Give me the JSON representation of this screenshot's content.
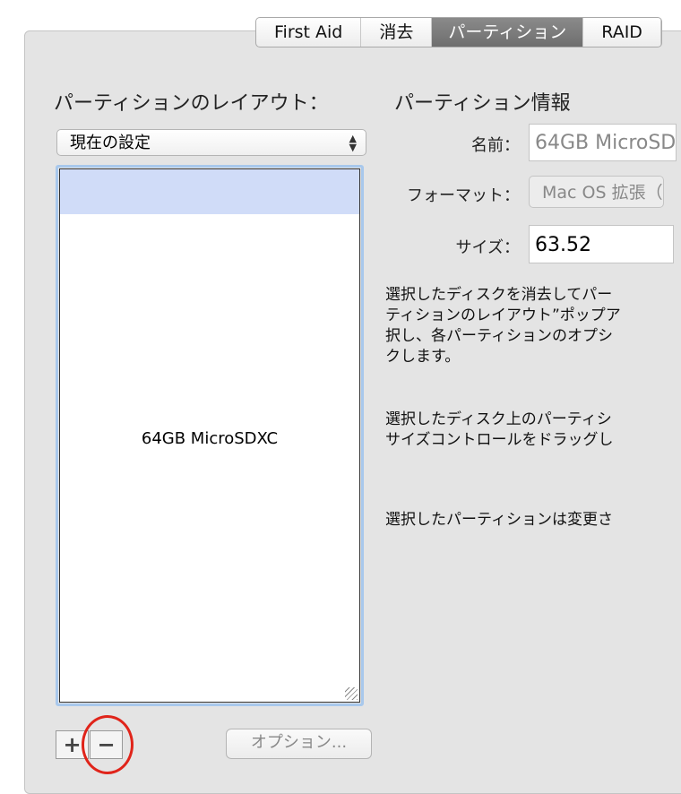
{
  "tabs": [
    "First Aid",
    "消去",
    "パーティション",
    "RAID"
  ],
  "active_tab": 2,
  "layout_heading": "パーティションのレイアウト：",
  "info_heading": "パーティション情報",
  "layout_popup": "現在の設定",
  "partition_name": "64GB MicroSDXC",
  "fields": {
    "name_label": "名前：",
    "name_value": "64GB MicroSD",
    "format_label": "フォーマット：",
    "format_value": "Mac OS 拡張（",
    "size_label": "サイズ：",
    "size_value": "63.52"
  },
  "desc1": "選択したディスクを消去してパー\nティションのレイアウト”ポップア\n択し、各パーティションのオプシ\nクします。",
  "desc2": "選択したディスク上のパーティシ\nサイズコントロールをドラッグし",
  "desc3": "選択したパーティションは変更さ",
  "buttons": {
    "add": "+",
    "remove": "−",
    "options": "オプション..."
  }
}
